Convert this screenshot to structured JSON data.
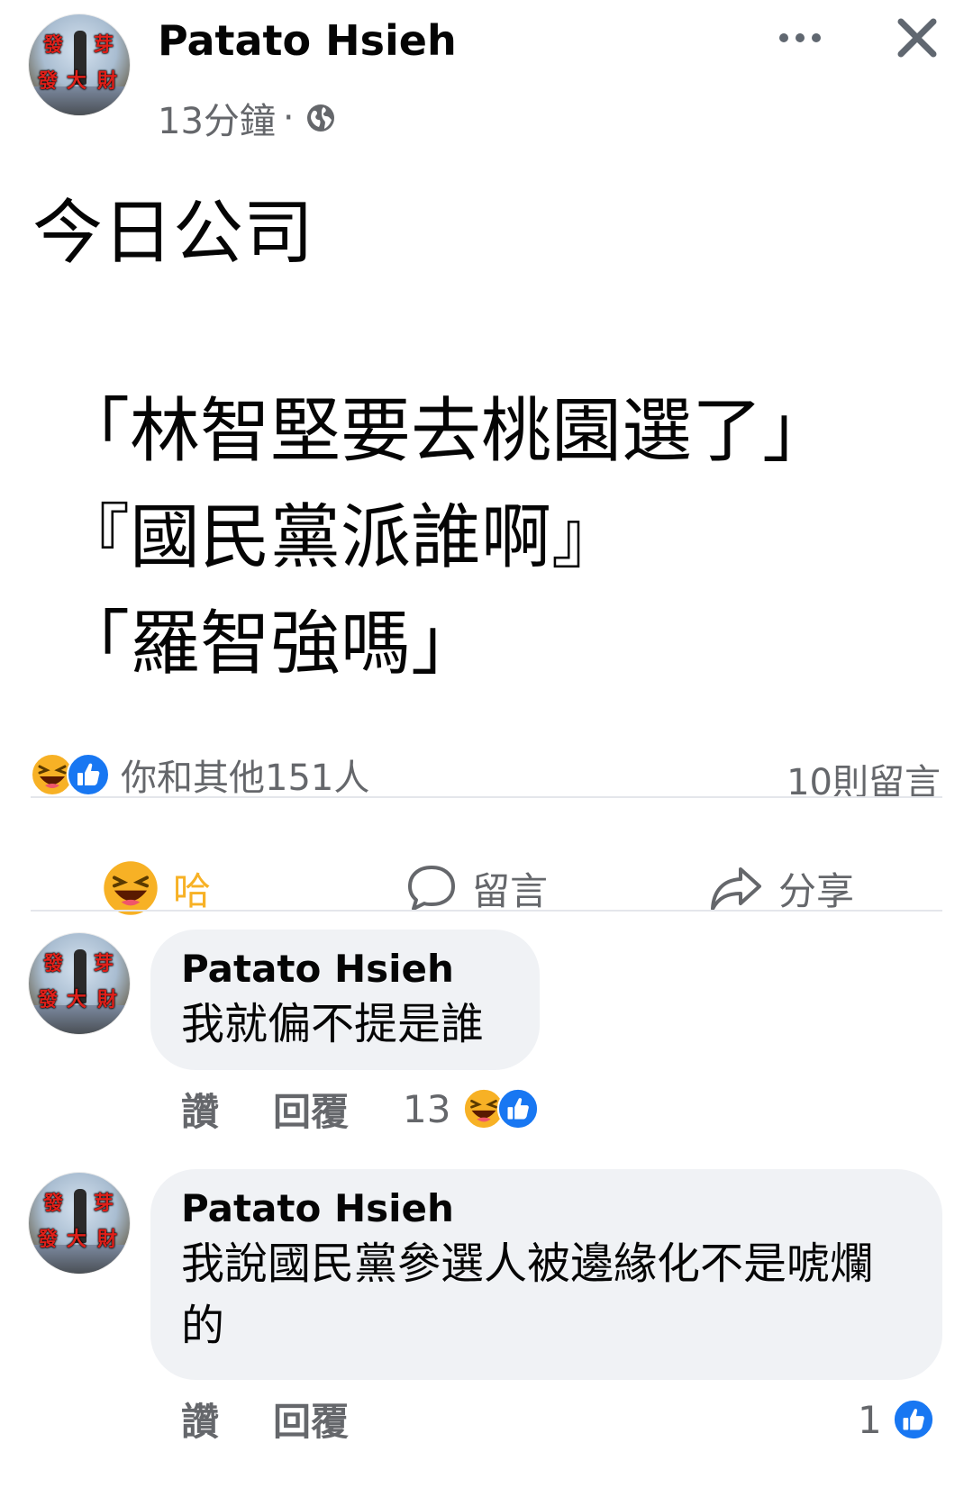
{
  "post": {
    "author": "Patato Hsieh",
    "time": "13分鐘",
    "separator": "·",
    "privacy_icon": "globe-icon",
    "body": "今日公司",
    "quotes": [
      "「林智堅要去桃園選了」",
      "『國民黨派誰啊』",
      "「羅智強嗎」"
    ]
  },
  "avatar": {
    "chars": [
      "發",
      "芽",
      "發",
      "大",
      "財"
    ]
  },
  "reactions": {
    "icons": [
      "haha-emoji-icon",
      "like-icon"
    ],
    "summary": "你和其他151人",
    "comments": "10則留言"
  },
  "actions": {
    "haha": "哈",
    "comment": "留言",
    "share": "分享"
  },
  "comments": [
    {
      "author": "Patato Hsieh",
      "text": "我就偏不提是誰",
      "like": "讚",
      "reply": "回覆",
      "react_count": "13"
    },
    {
      "author": "Patato Hsieh",
      "text": "我說國民黨參選人被邊緣化不是唬爛的",
      "like": "讚",
      "reply": "回覆",
      "react_count": "1"
    }
  ],
  "colors": {
    "haha": "#f7b125",
    "like": "#1877f2",
    "muted": "#65676b",
    "bubble": "#f0f2f5"
  }
}
